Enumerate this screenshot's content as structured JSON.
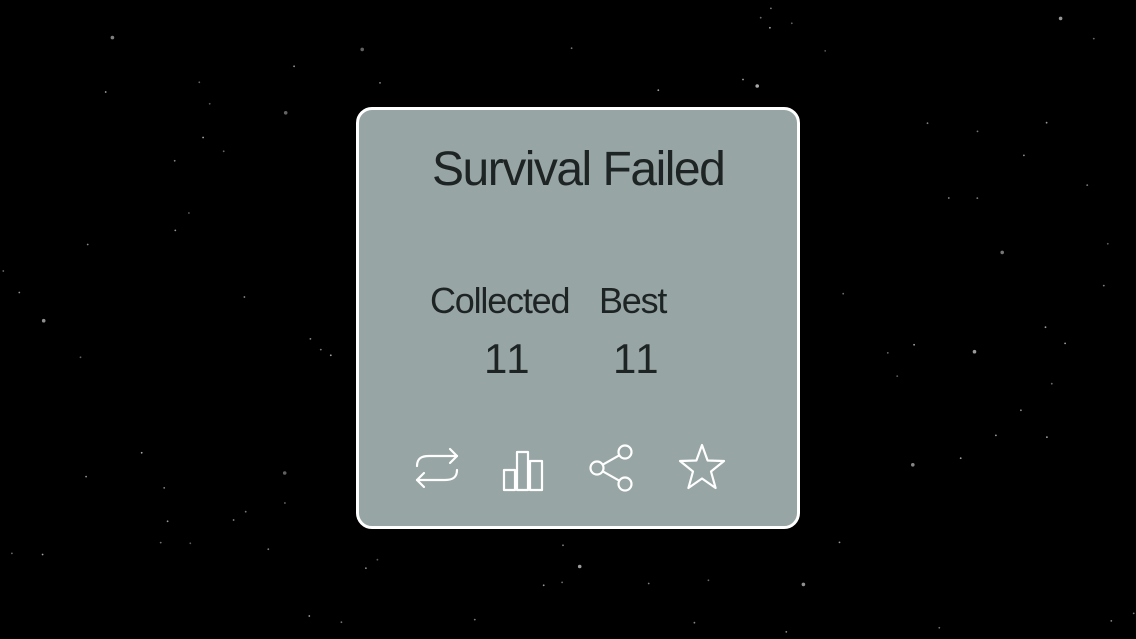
{
  "game_over": {
    "title": "Survival Failed",
    "stats": {
      "collected_label": "Collected",
      "collected_value": "11",
      "best_label": "Best",
      "best_value": "11"
    },
    "actions": [
      {
        "name": "retry-button",
        "icon": "repeat-icon"
      },
      {
        "name": "leaderboard-button",
        "icon": "bar-chart-icon"
      },
      {
        "name": "share-button",
        "icon": "share-icon"
      },
      {
        "name": "rate-button",
        "icon": "star-icon"
      }
    ]
  },
  "colors": {
    "background": "#000000",
    "panel": "#97a5a5",
    "panel_border": "#ffffff",
    "text": "#1e2323",
    "icon": "#ffffff"
  }
}
